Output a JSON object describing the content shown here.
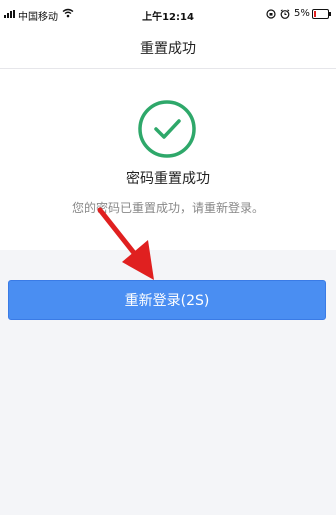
{
  "status_bar": {
    "carrier": "中国移动",
    "time": "上午12:14",
    "battery_percent": "5%"
  },
  "header": {
    "title": "重置成功"
  },
  "success": {
    "title": "密码重置成功",
    "message": "您的密码已重置成功，请重新登录。"
  },
  "relogin_button": {
    "label": "重新登录(2S)"
  },
  "colors": {
    "accent": "#4a8ef2",
    "success": "#2ea86a",
    "annotation": "#e02020"
  },
  "icons": [
    "signal-icon",
    "wifi-icon",
    "rotation-lock-icon",
    "alarm-icon",
    "battery-icon",
    "check-circle-icon",
    "red-arrow-annotation"
  ]
}
